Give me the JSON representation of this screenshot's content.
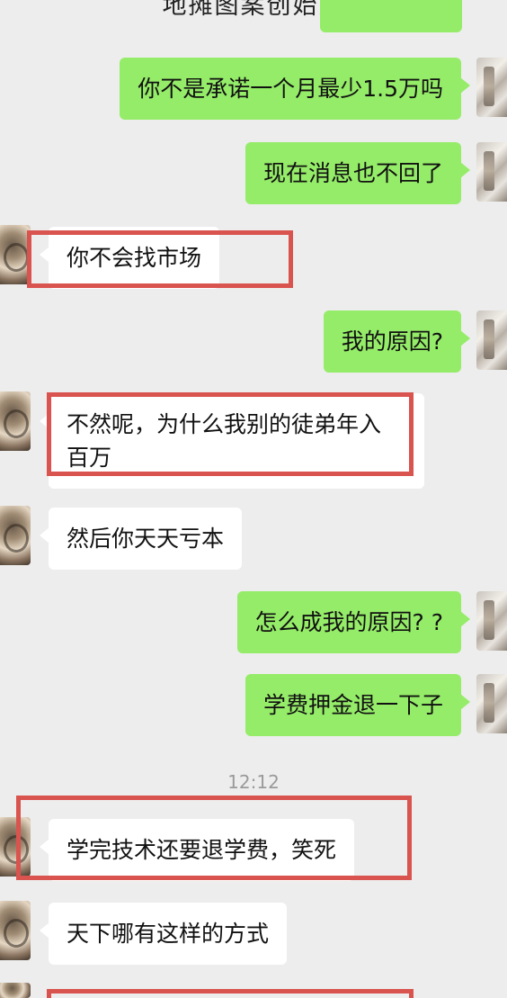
{
  "header": {
    "title": "地摊图案创始人"
  },
  "messages": [
    {
      "side": "me",
      "text": "你不是承诺一个月最少1.5万吗"
    },
    {
      "side": "me",
      "text": "现在消息也不回了"
    },
    {
      "side": "other",
      "text": "你不会找市场"
    },
    {
      "side": "me",
      "text": "我的原因?"
    },
    {
      "side": "other",
      "text": "不然呢，为什么我别的徒弟年入\n百万"
    },
    {
      "side": "other",
      "text": "然后你天天亏本"
    },
    {
      "side": "me",
      "text": "怎么成我的原因? ?"
    },
    {
      "side": "me",
      "text": "学费押金退一下子"
    },
    {
      "side": "other",
      "text": "学完技术还要退学费，笑死"
    },
    {
      "side": "other",
      "text": "天下哪有这样的方式"
    }
  ],
  "timestamp": "12:12",
  "colors": {
    "me_bubble": "#95ec69",
    "other_bubble": "#ffffff",
    "highlight": "#d9534f",
    "background": "#ededed"
  }
}
